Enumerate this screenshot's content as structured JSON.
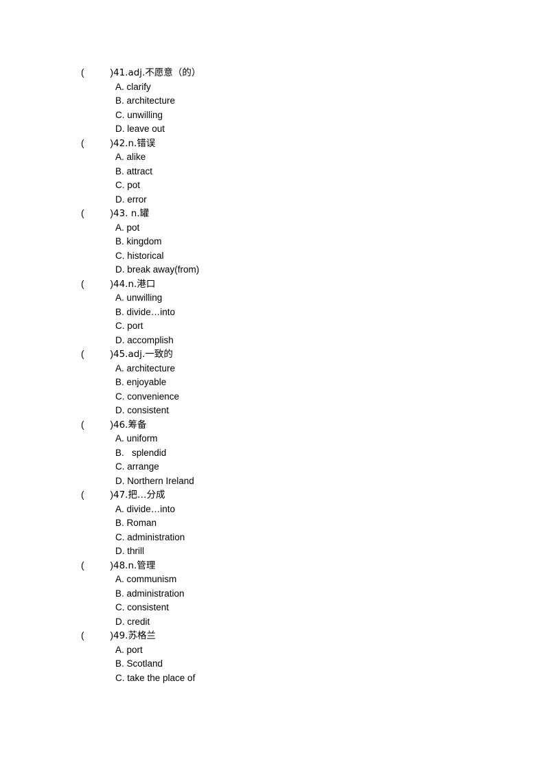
{
  "document": {
    "type": "vocabulary-multiple-choice-worksheet",
    "bracket_open": "(",
    "bracket_close": ")",
    "text_color": "#000000",
    "background_color": "#ffffff"
  },
  "questions": [
    {
      "number": "41.",
      "stem": "41.adj.不愿意（的）",
      "options": [
        {
          "label": "A.",
          "text": "A. clarify"
        },
        {
          "label": "B.",
          "text": "B. architecture"
        },
        {
          "label": "C.",
          "text": "C. unwilling"
        },
        {
          "label": "D.",
          "text": "D. leave out"
        }
      ]
    },
    {
      "number": "42.",
      "stem": "42.n.错误",
      "options": [
        {
          "label": "A.",
          "text": "A. alike"
        },
        {
          "label": "B.",
          "text": "B. attract"
        },
        {
          "label": "C.",
          "text": "C. pot"
        },
        {
          "label": "D.",
          "text": "D. error"
        }
      ]
    },
    {
      "number": "43.",
      "stem": "43. n.罐",
      "options": [
        {
          "label": "A.",
          "text": "A. pot"
        },
        {
          "label": "B.",
          "text": "B. kingdom"
        },
        {
          "label": "C.",
          "text": "C. historical"
        },
        {
          "label": "D.",
          "text": "D. break away(from)"
        }
      ]
    },
    {
      "number": "44.",
      "stem": "44.n.港口",
      "options": [
        {
          "label": "A.",
          "text": "A. unwilling"
        },
        {
          "label": "B.",
          "text": "B. divide…into"
        },
        {
          "label": "C.",
          "text": "C. port"
        },
        {
          "label": "D.",
          "text": "D. accomplish"
        }
      ]
    },
    {
      "number": "45.",
      "stem": "45.adj.一致的",
      "options": [
        {
          "label": "A.",
          "text": "A. architecture"
        },
        {
          "label": "B.",
          "text": "B. enjoyable"
        },
        {
          "label": "C.",
          "text": "C. convenience"
        },
        {
          "label": "D.",
          "text": "D. consistent"
        }
      ]
    },
    {
      "number": "46.",
      "stem": "46.筹备",
      "options": [
        {
          "label": "A.",
          "text": "A. uniform"
        },
        {
          "label": "B.",
          "text": "B.   splendid"
        },
        {
          "label": "C.",
          "text": "C. arrange"
        },
        {
          "label": "D.",
          "text": "D. Northern Ireland"
        }
      ]
    },
    {
      "number": "47.",
      "stem": "47.把…分成",
      "options": [
        {
          "label": "A.",
          "text": "A. divide…into"
        },
        {
          "label": "B.",
          "text": "B. Roman"
        },
        {
          "label": "C.",
          "text": "C. administration"
        },
        {
          "label": "D.",
          "text": "D. thrill"
        }
      ]
    },
    {
      "number": "48.",
      "stem": "48.n.管理",
      "options": [
        {
          "label": "A.",
          "text": "A. communism"
        },
        {
          "label": "B.",
          "text": "B. administration"
        },
        {
          "label": "C.",
          "text": "C. consistent"
        },
        {
          "label": "D.",
          "text": "D. credit"
        }
      ]
    },
    {
      "number": "49.",
      "stem": "49.苏格兰",
      "options": [
        {
          "label": "A.",
          "text": "A. port"
        },
        {
          "label": "B.",
          "text": "B. Scotland"
        },
        {
          "label": "C.",
          "text": "C. take the place of"
        }
      ]
    }
  ]
}
